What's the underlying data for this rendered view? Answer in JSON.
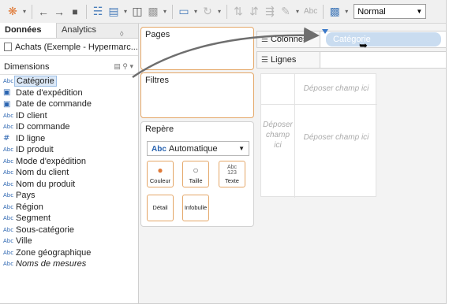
{
  "toolbar": {
    "icons": [
      "tableau-icon",
      "back-icon",
      "forward-icon",
      "save-icon",
      "add-datasource-icon",
      "new-sheet-icon",
      "new-dashboard-icon",
      "duplicate-icon",
      "sort-icon",
      "refresh-icon",
      "swap-icon",
      "sort-asc-icon",
      "sort-desc-icon",
      "highlight-icon",
      "labels-icon",
      "showme-icon"
    ],
    "abc_label": "Abc",
    "size_value": "Normal"
  },
  "sidebar": {
    "tabs": [
      {
        "label": "Données"
      },
      {
        "label": "Analytics"
      }
    ],
    "datasource": "Achats (Exemple - Hypermarc...",
    "dimensions_label": "Dimensions",
    "fields": [
      {
        "type": "Abc",
        "label": "Catégorie"
      },
      {
        "type": "cal",
        "label": "Date d'expédition"
      },
      {
        "type": "cal",
        "label": "Date de commande"
      },
      {
        "type": "Abc",
        "label": "ID client"
      },
      {
        "type": "Abc",
        "label": "ID commande"
      },
      {
        "type": "#",
        "label": "ID ligne"
      },
      {
        "type": "Abc",
        "label": "ID produit"
      },
      {
        "type": "Abc",
        "label": "Mode d'expédition"
      },
      {
        "type": "Abc",
        "label": "Nom du client"
      },
      {
        "type": "Abc",
        "label": "Nom du produit"
      },
      {
        "type": "Abc",
        "label": "Pays"
      },
      {
        "type": "Abc",
        "label": "Région"
      },
      {
        "type": "Abc",
        "label": "Segment"
      },
      {
        "type": "Abc",
        "label": "Sous-catégorie"
      },
      {
        "type": "Abc",
        "label": "Ville"
      },
      {
        "type": "Abc",
        "label": "Zone géographique"
      },
      {
        "type": "Abc",
        "label": "Noms de mesures"
      }
    ]
  },
  "cards": {
    "pages": "Pages",
    "filters": "Filtres",
    "marks": "Repère",
    "marks_abc": "Abc",
    "marks_type": "Automatique",
    "buttons": {
      "color": "Couleur",
      "size": "Taille",
      "text": "Texte",
      "detail": "Détail",
      "tooltip": "Infobulle"
    },
    "text_icon": [
      "Abc",
      "123"
    ]
  },
  "shelves": {
    "columns": "Colonnes",
    "rows": "Lignes",
    "drag_pill": "Catégorie"
  },
  "canvas": {
    "drop_field_top": "Déposer champ ici",
    "drop_field_left": [
      "Déposer",
      "champ",
      "ici"
    ],
    "drop_field_center": "Déposer champ ici"
  },
  "colors": {
    "accent_border": "#e4a667",
    "selection": "#dbe8f7",
    "pill": "#c9dcf0"
  }
}
